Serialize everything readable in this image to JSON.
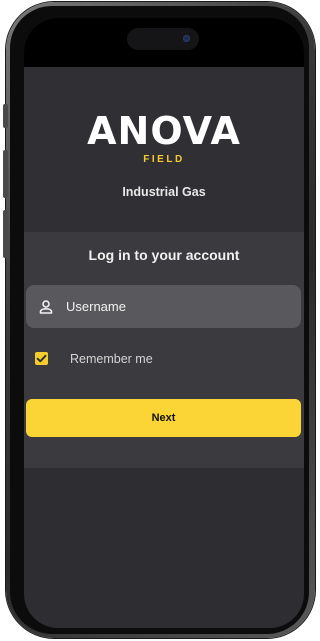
{
  "brand": {
    "name": "ANOVA",
    "sub": "FIELD",
    "subtitle": "Industrial Gas"
  },
  "login": {
    "title": "Log in to your account",
    "username_placeholder": "Username",
    "username_value": "",
    "remember_label": "Remember me",
    "remember_checked": true,
    "next_label": "Next"
  },
  "icons": {
    "user": "person-icon",
    "check": "checkmark-icon"
  },
  "colors": {
    "accent": "#fbd535",
    "background": "#2e2d31",
    "card": "#3b3a3e",
    "field": "#59585c"
  }
}
